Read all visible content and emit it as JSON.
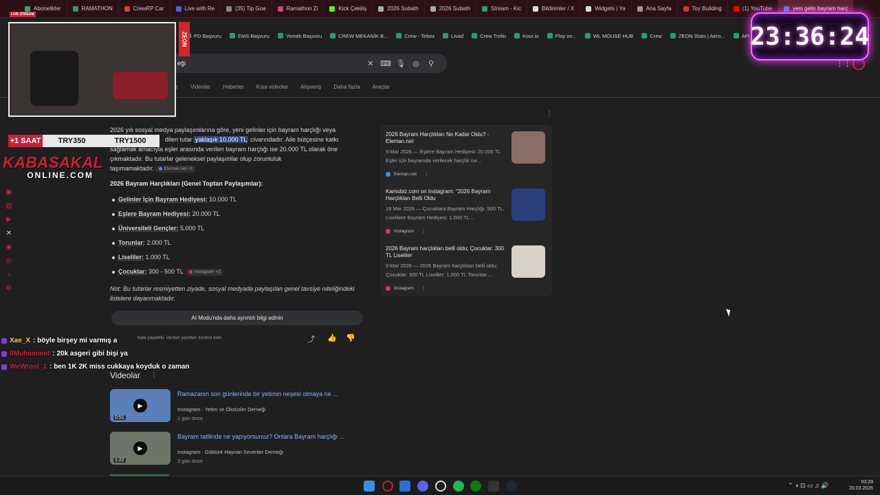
{
  "tabs": [
    {
      "label": "Abonelikler",
      "color": "#2aa86a"
    },
    {
      "label": "RAMATHON",
      "color": "#1ea362"
    },
    {
      "label": "CrewRP Car",
      "color": "#d23c3c"
    },
    {
      "label": "Live with Re",
      "color": "#3a6bd8"
    },
    {
      "label": "(35) Tip Goa",
      "color": "#888888"
    },
    {
      "label": "Ramathon Zi",
      "color": "#c34a7a"
    },
    {
      "label": "Kick Çekiliş",
      "color": "#53fc18"
    },
    {
      "label": "2026 Subath",
      "color": "#aaaaaa"
    },
    {
      "label": "2026 Subath",
      "color": "#aaaaaa"
    },
    {
      "label": "Stream - Kic",
      "color": "#1ea362"
    },
    {
      "label": "Bildirimler / X",
      "color": "#dddddd"
    },
    {
      "label": "Widgets | Ya",
      "color": "#dddddd"
    },
    {
      "label": "Ana Sayfa",
      "color": "#999999"
    },
    {
      "label": "Toy Building",
      "color": "#e03030"
    },
    {
      "label": "(1) YouTube",
      "color": "#ff0000"
    },
    {
      "label": "yeni gelin bayram harç",
      "color": "#4285f4"
    }
  ],
  "bookmarks": [
    "PD Başvuru",
    "EMS Başvuru",
    "Yemek Başvuru",
    "CREW MEKANİK B...",
    "Crew - Tebex",
    "Livad",
    "Crew Trello",
    "Kour.io",
    "Play on...",
    "WL MOUSE HUB",
    "Crew",
    "ZEON Stats | Aero...",
    "APIq"
  ],
  "search": {
    "query": "eği"
  },
  "nav_tabs": [
    "ler",
    "Videolar",
    "Haberler",
    "Kısa videolar",
    "Alışveriş",
    "Daha fazla",
    "Araçlar"
  ],
  "ai": {
    "p1_a": "2026 yılı sosyal medya paylaşımlarına göre, yeni gelinler için bayram harçlığı veya",
    "p1_b": "dilen tutar",
    "p1_hl": "yaklaşık 10.000 TL",
    "p1_c": "civarındadır. Aile bütçesine katkı",
    "p1_d": "sağlamak amacıyla eşler arasında verilen bayram harçlığı ise 20.000 TL olarak öne",
    "p1_e": "çıkmaktadır. Bu tutarlar geleneksel paylaşımlar olup zorunluluk",
    "p1_f": "taşımamaktadır.",
    "chip1": "Eleman.net +1",
    "list_title": "2026 Bayram Harçlıkları (Genel Toptan Paylaşımlar):",
    "items": [
      {
        "k": "Gelinler İçin Bayram Hediyesi:",
        "v": " 10.000 TL"
      },
      {
        "k": "Eşlere Bayram Hediyesi:",
        "v": " 20.000 TL"
      },
      {
        "k": "Üniversiteli Gençler:",
        "v": " 5.000 TL"
      },
      {
        "k": "Torunlar:",
        "v": " 2.000 TL"
      },
      {
        "k": "Liseliler:",
        "v": " 1.000 TL"
      },
      {
        "k": "Çocuklar:",
        "v": " 300 - 500 TL"
      }
    ],
    "chip2": "Instagram +2",
    "note": "Not: Bu tutarlar resmiyetten ziyade, sosyal medyada paylaşılan genel tavsiye niteliğindeki listelere dayanmaktadır.",
    "ai_mode_button": "AI Modu'nda daha ayrıntılı bilgi edinin",
    "disclaimer": "hata yapabilir. Verilen yanıtları kontrol edin"
  },
  "sources": [
    {
      "title": "2026 Bayram Harçlıkları Ne Kadar Oldu? - Eleman.net",
      "snippet": "9 Mar 2026 — Eşlere Bayram Hediyesi: 20.000 TL Eşler için bayramda verilecek harçlık ise...",
      "site": "Eleman.net",
      "site_color": "#4d8cf5",
      "thumb": "#8a6f66"
    },
    {
      "title": "Kamubiz.com on Instagram: \"2026 Bayram Harçlıkları Belli Oldu",
      "snippet": "18 Mar 2026 — Çocuklara Bayram Harçlığı: 500 TL. Liselilere Bayram Hediyesi: 1.000 TL...",
      "site": "Instagram",
      "site_color": "#e1306c",
      "thumb": "#2b3f7a"
    },
    {
      "title": "2026 Bayram harçlıkları belli oldu; Çocuklar: 300 TL Liseliler",
      "snippet": "9 Mar 2026 — 2026 Bayram harçlıkları belli oldu; Çocuklar: 300 TL Liseliler: 1.000 TL Torunlar:...",
      "site": "Instagram",
      "site_color": "#e1306c",
      "thumb": "#d9d2c8"
    }
  ],
  "clock": "23:36:24",
  "overlay": {
    "zeon": "ZEON",
    "saat_label": "+1 SAAT",
    "price1": "TRY350",
    "price2": "TRY1500",
    "brand_line1": "KABASAKAL",
    "brand_line2": "ONLINE.COM",
    "live": "LIVE STREAM"
  },
  "chat": [
    {
      "user": "Xae_X",
      "user_color": "#ffd24a",
      "msg": ": böyle birşey mi varmış a"
    },
    {
      "user": "0Muhammet",
      "user_color": "#c8203b",
      "msg": ": 20k asgeri gibi bişi ya"
    },
    {
      "user": "WeWrost_1",
      "user_color": "#c8203b",
      "msg": ": ben 1K 2K miss cukkaya koyduk o zaman"
    }
  ],
  "videos_heading": "Videolar",
  "videos": [
    {
      "title": "Ramazanın son günlerinde bir yetimin neşesi olmaya ne ...",
      "source": "Instagram · Yetim ve Öksüzler Derneği",
      "time": "1 gün önce",
      "duration": "0:51",
      "thumb": "#5b7fb8"
    },
    {
      "title": "Bayram tatilinde ne yapıyorsunuz? Onlara Bayram harçlığı ...",
      "source": "Instagram · Göktürk Hayvan Sevenler Derneği",
      "time": "3 gün önce",
      "duration": "1:22",
      "thumb": "#6f7468"
    }
  ],
  "taskbar": {
    "time": "03:29",
    "date": "20.03.2026"
  }
}
